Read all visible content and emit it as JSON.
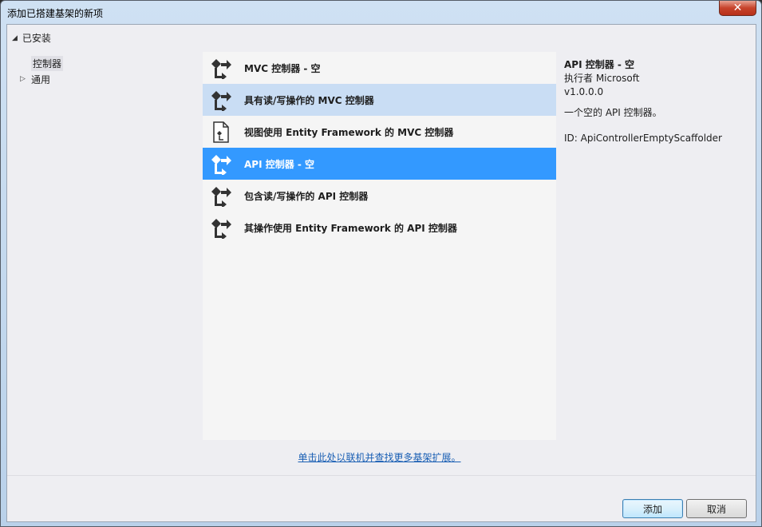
{
  "window": {
    "title": "添加已搭建基架的新项",
    "close_glyph": "✕"
  },
  "tree": {
    "installed_label": "已安装",
    "items": [
      {
        "label": "控制器",
        "selected": true,
        "expander": ""
      },
      {
        "label": "通用",
        "selected": false,
        "expander": "▷"
      }
    ]
  },
  "list": {
    "items": [
      {
        "label": "MVC 控制器 - 空",
        "state": "normal",
        "icon": "controller-icon"
      },
      {
        "label": "具有读/写操作的 MVC 控制器",
        "state": "hover",
        "icon": "controller-icon"
      },
      {
        "label": "视图使用 Entity Framework 的 MVC 控制器",
        "state": "normal",
        "icon": "document-controller-icon"
      },
      {
        "label": "API 控制器 - 空",
        "state": "selected",
        "icon": "controller-icon"
      },
      {
        "label": "包含读/写操作的 API 控制器",
        "state": "normal",
        "icon": "controller-icon"
      },
      {
        "label": "其操作使用 Entity Framework 的 API 控制器",
        "state": "normal",
        "icon": "controller-icon"
      }
    ]
  },
  "link_text": "单击此处以联机并查找更多基架扩展。",
  "details": {
    "title": "API 控制器 - 空",
    "author": "执行者 Microsoft",
    "version": "v1.0.0.0",
    "description": "一个空的 API 控制器。",
    "id": "ID: ApiControllerEmptyScaffolder"
  },
  "buttons": {
    "add": "添加",
    "cancel": "取消"
  },
  "colors": {
    "selected_bg": "#3399ff",
    "hover_bg": "#c9ddf4",
    "link": "#1a5fb4"
  }
}
